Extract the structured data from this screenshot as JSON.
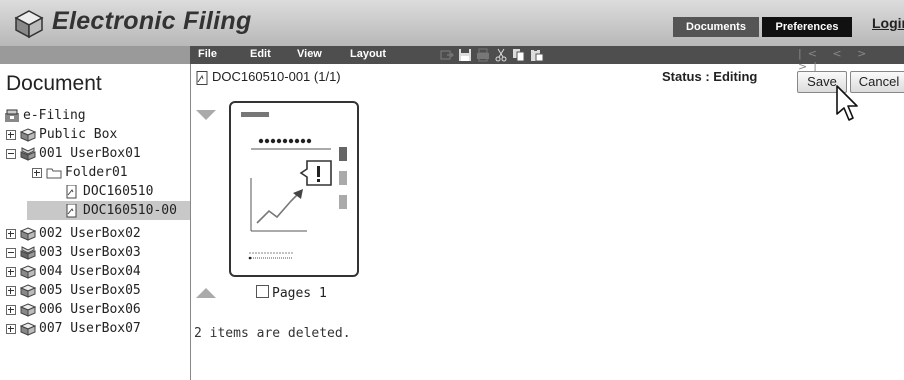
{
  "header": {
    "app_title": "Electronic Filing",
    "logo_icon": "e-filing-box-icon",
    "documents_label": "Documents",
    "preferences_label": "Preferences",
    "login_label": "Login"
  },
  "menubar": {
    "items": [
      "File",
      "Edit",
      "View",
      "Layout"
    ],
    "tool_icons": [
      "copy-to-icon",
      "save-icon",
      "print-icon",
      "cut-icon",
      "copy-icon",
      "paste-icon"
    ],
    "nav_icons": [
      "first-page-icon",
      "previous-page-icon",
      "next-page-icon",
      "last-page-icon"
    ],
    "nav_glyphs": "|< < > >|"
  },
  "left_panel": {
    "title": "Document",
    "tree": [
      {
        "label": "e-Filing",
        "level": 0,
        "icon": "efiling-root-icon",
        "expander": "none"
      },
      {
        "label": "Public Box",
        "level": 1,
        "icon": "box-icon",
        "expander": "plus"
      },
      {
        "label": "001 UserBox01",
        "level": 1,
        "icon": "open-box-icon",
        "expander": "minus"
      },
      {
        "label": "Folder01",
        "level": 2,
        "icon": "folder-icon",
        "expander": "plus"
      },
      {
        "label": "DOC160510",
        "level": 3,
        "icon": "document-icon",
        "expander": "none"
      },
      {
        "label": "DOC160510-00",
        "level": 3,
        "icon": "document-icon",
        "expander": "none",
        "selected": true
      },
      {
        "label": "002 UserBox02",
        "level": 1,
        "icon": "box-icon",
        "expander": "plus"
      },
      {
        "label": "003 UserBox03",
        "level": 1,
        "icon": "open-box-icon",
        "expander": "minus"
      },
      {
        "label": "004 UserBox04",
        "level": 1,
        "icon": "box-icon",
        "expander": "plus"
      },
      {
        "label": "005 UserBox05",
        "level": 1,
        "icon": "box-icon",
        "expander": "plus"
      },
      {
        "label": "006 UserBox06",
        "level": 1,
        "icon": "box-icon",
        "expander": "plus"
      },
      {
        "label": "007 UserBox07",
        "level": 1,
        "icon": "box-icon",
        "expander": "plus"
      }
    ]
  },
  "content": {
    "doc_title": "DOC160510-001 (1/1)",
    "status": "Status : Editing",
    "save_label": "Save",
    "cancel_label": "Cancel",
    "page_checkbox_label": "Pages 1",
    "deleted_message": "2 items are deleted."
  },
  "colors": {
    "menubar_dark": "#4e4e4e",
    "documents_btn": "#555555",
    "preferences_btn": "#111111",
    "selected_row": "#c8c8c8"
  }
}
